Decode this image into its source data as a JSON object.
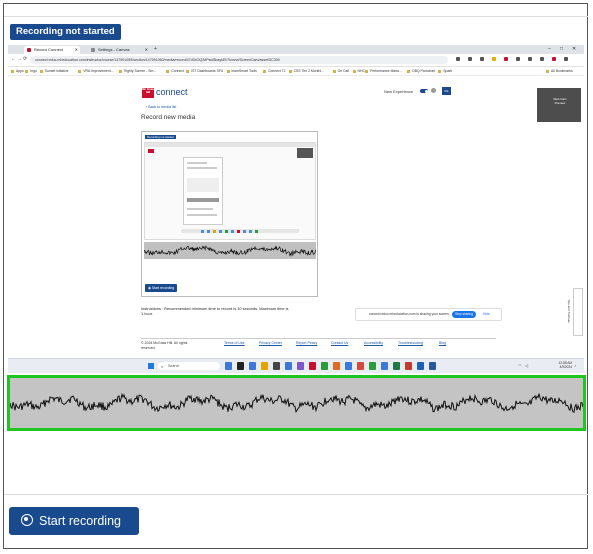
{
  "status_badge": "Recording not started",
  "browser": {
    "tabs": [
      {
        "label": "Record Connect",
        "favicon_color": "#c8102e",
        "active": true
      },
      {
        "label": "Settings - Canvas",
        "favicon_color": "#888888",
        "active": false
      }
    ],
    "new_tab": "+",
    "window_controls": [
      "–",
      "□",
      "✕"
    ],
    "url": "connect.educ.mheducation.com/instructor/course/147591059/section/147591060/media/record/47d34OQ/MPsd/8baykEl/7k/new/ScreenCam/asset/5C300",
    "nav": {
      "back": "←",
      "forward": "→",
      "reload": "⟳",
      "home": "⌂"
    },
    "extension_colors": [
      "#555555",
      "#555555",
      "#555555",
      "#e0b000",
      "#c8102e",
      "#555555",
      "#555555",
      "#555555",
      "#c8102e",
      "#555555"
    ],
    "bookmarks": [
      "Apps",
      "Ingo",
      "Sunset initiative",
      "VRA Improvement...",
      "Tegrity Screen - Sm...",
      "Connect",
      "IST Dashboards SFU",
      "learnSmart Tools",
      "Connect T2",
      "CSS Tier 2 Monthl...",
      "On Call",
      "NHC",
      "Performance Mana...",
      "DBQ Flowchart",
      "Spark"
    ],
    "all_bookmarks": "All Bookmarks"
  },
  "page": {
    "brand_logo": "Mc Graw Hill",
    "brand_name": "connect",
    "new_experience_label": "New Experience",
    "user_initials": "KE",
    "camera_label": "Web Cam Preview",
    "back_link": "‹ Back to media list",
    "heading": "Record new media",
    "preview": {
      "badge": "Recording not started",
      "record_button": "◉ Start recording"
    },
    "instructions": "Instructions : Recommended minimum time to record is 10 seconds. Maximum time is 1 hour.",
    "share_bar": {
      "text": "connect.educ.mheducation.com is sharing your screen.",
      "stop_button": "Stop sharing",
      "hide_link": "Hide"
    },
    "side_tab": "Tips and Tutorials",
    "footer": {
      "copyright": "© 2024 McGraw Hill. All rights reserved.",
      "links": [
        "Terms of Use",
        "Privacy Center",
        "Report Piracy",
        "Contact Us",
        "Accessibility",
        "Troubleshooting",
        "Blog"
      ]
    }
  },
  "taskbar": {
    "search_placeholder": "Search",
    "app_colors": [
      "#3b78d8",
      "#222222",
      "#3b78d8",
      "#e8a200",
      "#444444",
      "#3b78d8",
      "#7f56c9",
      "#c8102e",
      "#2a9d3a",
      "#e06a20",
      "#3b78d8",
      "#d44a3a",
      "#2a9d3a",
      "#3b78d8",
      "#1e7a45",
      "#c13b2b",
      "#1e5fb8",
      "#2b579a"
    ],
    "time": "12:58 AM",
    "date": "4/9/2024"
  },
  "start_recording_label": "Start recording",
  "colors": {
    "accent": "#1a4a8e",
    "waveform_border": "#21c521",
    "waveform_fill": "#c4c4c4"
  }
}
